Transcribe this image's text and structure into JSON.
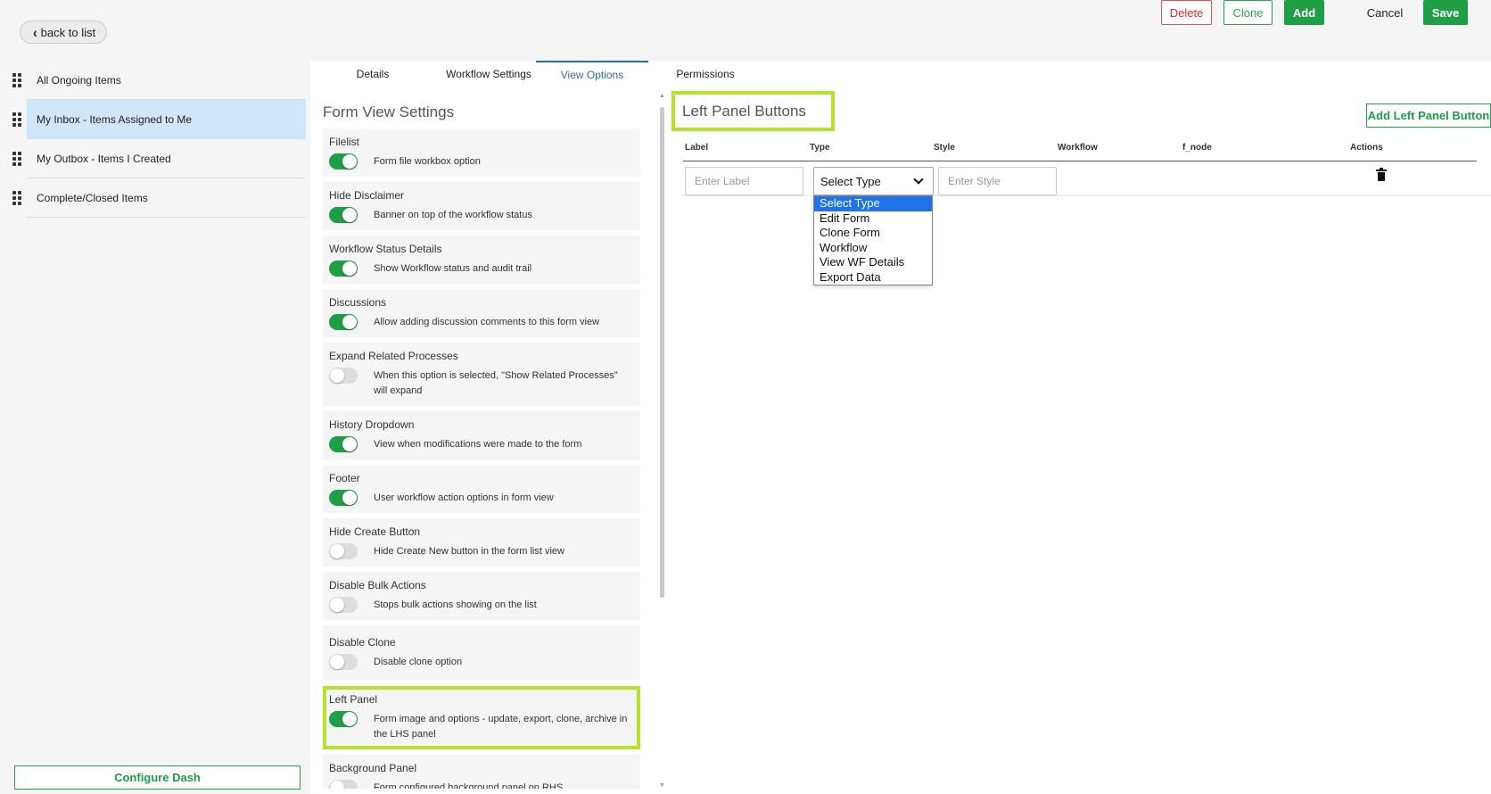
{
  "top_bar": {
    "back_label": "back to list",
    "delete_label": "Delete",
    "clone_label": "Clone",
    "add_label": "Add",
    "cancel_label": "Cancel",
    "save_label": "Save"
  },
  "sidebar": {
    "items": [
      {
        "label": "All Ongoing Items"
      },
      {
        "label": "My Inbox - Items Assigned to Me"
      },
      {
        "label": "My Outbox - Items I Created"
      },
      {
        "label": "Complete/Closed Items"
      }
    ],
    "configure_label": "Configure Dash"
  },
  "tabs": {
    "details": "Details",
    "workflow_settings": "Workflow Settings",
    "view_options": "View Options",
    "permissions": "Permissions"
  },
  "form_view": {
    "title": "Form View Settings",
    "settings": [
      {
        "title": "Filelist",
        "desc": "Form file workbox option",
        "on": true
      },
      {
        "title": "Hide Disclaimer",
        "desc": "Banner on top of the workflow status",
        "on": true
      },
      {
        "title": "Workflow Status Details",
        "desc": "Show Workflow status and audit trail",
        "on": true
      },
      {
        "title": "Discussions",
        "desc": "Allow adding discussion comments to this form view",
        "on": true
      },
      {
        "title": "Expand Related Processes",
        "desc": "When this option is selected, \"Show Related Processes\" will expand",
        "on": false
      },
      {
        "title": "History Dropdown",
        "desc": "View when modifications were made to the form",
        "on": true
      },
      {
        "title": "Footer",
        "desc": "User workflow action options in form view",
        "on": true
      },
      {
        "title": "Hide Create Button",
        "desc": "Hide Create New button in the form list view",
        "on": false
      },
      {
        "title": "Disable Bulk Actions",
        "desc": "Stops bulk actions showing on the list",
        "on": false
      },
      {
        "title": "Disable Clone",
        "desc": "Disable clone option",
        "on": false
      },
      {
        "title": "Left Panel",
        "desc": "Form image and options - update, export, clone, archive in the LHS panel",
        "on": true
      },
      {
        "title": "Background Panel",
        "desc": "Form configured background panel on RHS",
        "on": false
      }
    ]
  },
  "left_panel_buttons": {
    "title": "Left Panel Buttons",
    "add_label": "Add Left Panel Button",
    "columns": [
      "Label",
      "Type",
      "Style",
      "Workflow",
      "f_node",
      "Actions"
    ],
    "label_placeholder": "Enter Label",
    "style_placeholder": "Enter Style",
    "type_selected": "Select Type",
    "type_options": [
      "Select Type",
      "Edit Form",
      "Clone Form",
      "Workflow",
      "View WF Details",
      "Export Data"
    ]
  },
  "colors": {
    "accent_green": "#1e9e45",
    "highlight": "#b5e22a",
    "active_row": "#cfe6fb",
    "active_tab": "#2c6fa8",
    "danger": "#d32f2f"
  }
}
